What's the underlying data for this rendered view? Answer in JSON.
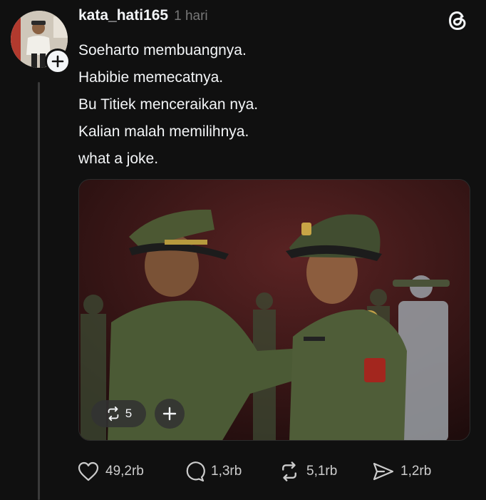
{
  "post": {
    "username": "kata_hati165",
    "time": "1 hari",
    "caption": [
      "Soeharto membuangnya.",
      "Habibie memecatnya.",
      "Bu Titiek menceraikan nya.",
      "Kalian malah memilihnya.",
      "what a joke."
    ]
  },
  "media": {
    "repost_count": "5",
    "add_icon": "plus-icon",
    "repost_icon": "repost-icon"
  },
  "actions": {
    "likes": "49,2rb",
    "replies": "1,3rb",
    "reposts": "5,1rb",
    "shares": "1,2rb"
  },
  "icons": {
    "like": "heart-icon",
    "reply": "comment-icon",
    "repost": "repost-icon",
    "share": "send-icon",
    "brand": "threads-logo-icon",
    "follow": "plus-icon"
  },
  "colors": {
    "background": "#101010",
    "text": "#f3f5f7",
    "muted": "#777777",
    "thread_line": "#3a3a3a"
  }
}
